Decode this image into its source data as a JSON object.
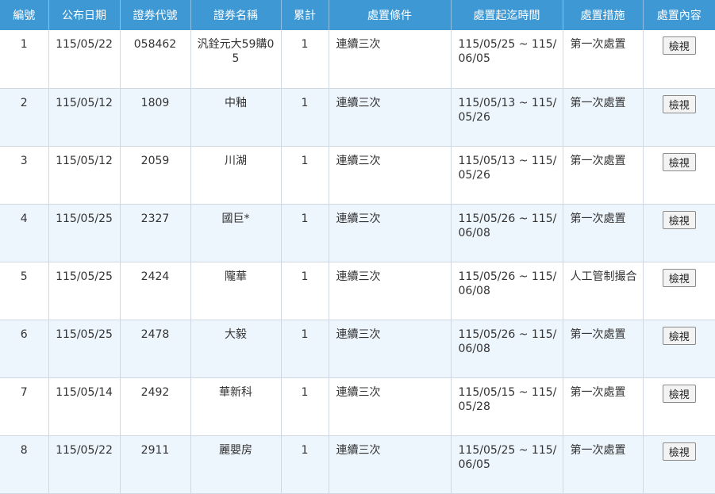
{
  "table": {
    "headers": [
      "編號",
      "公布日期",
      "證券代號",
      "證券名稱",
      "累計",
      "處置條件",
      "處置起迄時間",
      "處置措施",
      "處置內容"
    ],
    "rows": [
      {
        "no": "1",
        "date": "115/05/22",
        "code": "058462",
        "name": "汎銓元大59購05",
        "count": "1",
        "condition": "連續三次",
        "period": "115/05/25 ~ 115/06/05",
        "measure": "第一次處置",
        "action": "檢視"
      },
      {
        "no": "2",
        "date": "115/05/12",
        "code": "1809",
        "name": "中釉",
        "count": "1",
        "condition": "連續三次",
        "period": "115/05/13 ~ 115/05/26",
        "measure": "第一次處置",
        "action": "檢視"
      },
      {
        "no": "3",
        "date": "115/05/12",
        "code": "2059",
        "name": "川湖",
        "count": "1",
        "condition": "連續三次",
        "period": "115/05/13 ~ 115/05/26",
        "measure": "第一次處置",
        "action": "檢視"
      },
      {
        "no": "4",
        "date": "115/05/25",
        "code": "2327",
        "name": "國巨*",
        "count": "1",
        "condition": "連續三次",
        "period": "115/05/26 ~ 115/06/08",
        "measure": "第一次處置",
        "action": "檢視"
      },
      {
        "no": "5",
        "date": "115/05/25",
        "code": "2424",
        "name": "隴華",
        "count": "1",
        "condition": "連續三次",
        "period": "115/05/26 ~ 115/06/08",
        "measure": "人工管制撮合",
        "action": "檢視"
      },
      {
        "no": "6",
        "date": "115/05/25",
        "code": "2478",
        "name": "大毅",
        "count": "1",
        "condition": "連續三次",
        "period": "115/05/26 ~ 115/06/08",
        "measure": "第一次處置",
        "action": "檢視"
      },
      {
        "no": "7",
        "date": "115/05/14",
        "code": "2492",
        "name": "華新科",
        "count": "1",
        "condition": "連續三次",
        "period": "115/05/15 ~ 115/05/28",
        "measure": "第一次處置",
        "action": "檢視"
      },
      {
        "no": "8",
        "date": "115/05/22",
        "code": "2911",
        "name": "麗嬰房",
        "count": "1",
        "condition": "連續三次",
        "period": "115/05/25 ~ 115/06/05",
        "measure": "第一次處置",
        "action": "檢視"
      }
    ]
  }
}
